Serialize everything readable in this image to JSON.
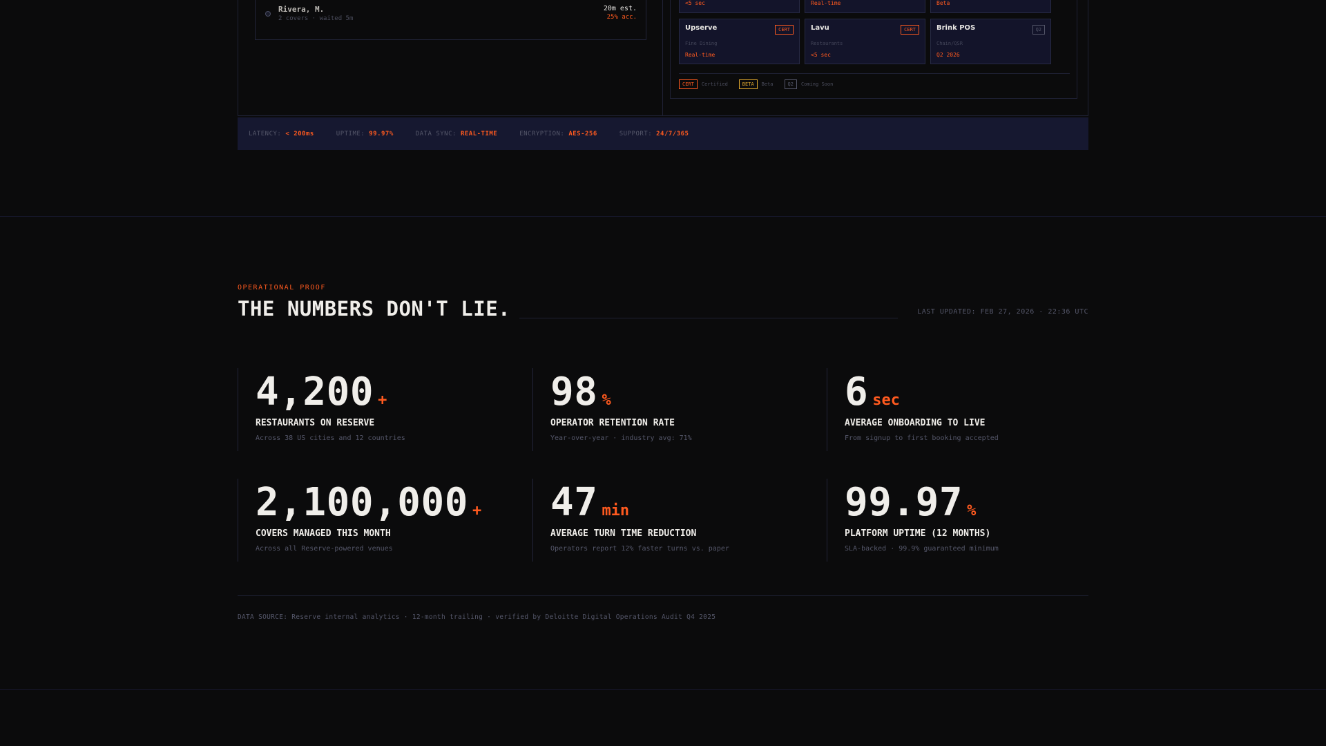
{
  "queue": {
    "name": "Rivera, M.",
    "meta": "2 covers · waited 5m",
    "estimate": "20m est.",
    "accuracy": "25% acc."
  },
  "integrations": {
    "partial_row": [
      {
        "value": "<5 sec"
      },
      {
        "value": "Real-time"
      },
      {
        "value": "Beta"
      }
    ],
    "cards": [
      {
        "name": "Upserve",
        "badge": "CERT",
        "type": "Fine Dining",
        "speed": "Real-time"
      },
      {
        "name": "Lavu",
        "badge": "CERT",
        "type": "Restaurants",
        "speed": "<5 sec"
      },
      {
        "name": "Brink POS",
        "badge": "Q2",
        "type": "Chain/QSR",
        "speed": "Q2 2026"
      }
    ],
    "legend": [
      {
        "badge": "CERT",
        "label": "Certified"
      },
      {
        "badge": "BETA",
        "label": "Beta"
      },
      {
        "badge": "Q2",
        "label": "Coming Soon"
      }
    ]
  },
  "status_bar": [
    {
      "key": "LATENCY:",
      "value": "< 200ms"
    },
    {
      "key": "UPTIME:",
      "value": "99.97%"
    },
    {
      "key": "DATA SYNC:",
      "value": "REAL-TIME"
    },
    {
      "key": "ENCRYPTION:",
      "value": "AES-256"
    },
    {
      "key": "SUPPORT:",
      "value": "24/7/365"
    }
  ],
  "section": {
    "eyebrow": "OPERATIONAL PROOF",
    "title": "THE NUMBERS DON'T LIE.",
    "updated": "LAST UPDATED: FEB 27, 2026 · 22:36 UTC"
  },
  "stats": [
    {
      "value": "4,200",
      "suffix": "+",
      "label": "RESTAURANTS ON RESERVE",
      "desc": "Across 38 US cities and 12 countries"
    },
    {
      "value": "98",
      "suffix": "%",
      "label": "OPERATOR RETENTION RATE",
      "desc": "Year-over-year · industry avg: 71%"
    },
    {
      "value": "6",
      "suffix": "sec",
      "label": "AVERAGE ONBOARDING TO LIVE",
      "desc": "From signup to first booking accepted"
    },
    {
      "value": "2,100,000",
      "suffix": "+",
      "label": "COVERS MANAGED THIS MONTH",
      "desc": "Across all Reserve-powered venues"
    },
    {
      "value": "47",
      "suffix": "min",
      "label": "AVERAGE TURN TIME REDUCTION",
      "desc": "Operators report 12% faster turns vs. paper"
    },
    {
      "value": "99.97",
      "suffix": "%",
      "label": "PLATFORM UPTIME (12 MONTHS)",
      "desc": "SLA-backed · 99.9% guaranteed minimum"
    }
  ],
  "footer": {
    "source": "DATA SOURCE: Reserve internal analytics · 12-month trailing · verified by Deloitte Digital Operations Audit Q4 2025"
  }
}
